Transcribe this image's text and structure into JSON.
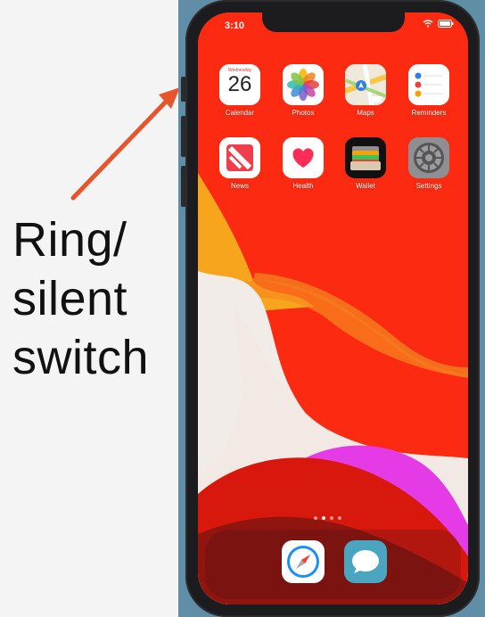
{
  "annotation": {
    "label": "Ring/\nsilent\nswitch",
    "arrow_color": "#e8542b"
  },
  "status_bar": {
    "time": "3:10",
    "icons": [
      "wifi-icon",
      "battery-icon"
    ]
  },
  "home_screen": {
    "apps": [
      {
        "name": "Calendar",
        "icon": "calendar-icon",
        "weekday": "Wednesday",
        "day": "26"
      },
      {
        "name": "Photos",
        "icon": "photos-icon"
      },
      {
        "name": "Maps",
        "icon": "maps-icon",
        "badge": "280"
      },
      {
        "name": "Reminders",
        "icon": "reminders-icon"
      },
      {
        "name": "News",
        "icon": "news-icon"
      },
      {
        "name": "Health",
        "icon": "health-icon"
      },
      {
        "name": "Wallet",
        "icon": "wallet-icon"
      },
      {
        "name": "Settings",
        "icon": "settings-icon"
      }
    ],
    "page_count": 4,
    "active_page": 2
  },
  "dock": {
    "apps": [
      {
        "icon": "safari-icon"
      },
      {
        "icon": "messages-icon"
      }
    ]
  },
  "colors": {
    "wallpaper_red": "#fb2a10",
    "wallpaper_orange": "#f7a51c",
    "wallpaper_magenta": "#e53be6",
    "backdrop": "#5f8ea6",
    "phone_frame": "#1c1c1e"
  }
}
